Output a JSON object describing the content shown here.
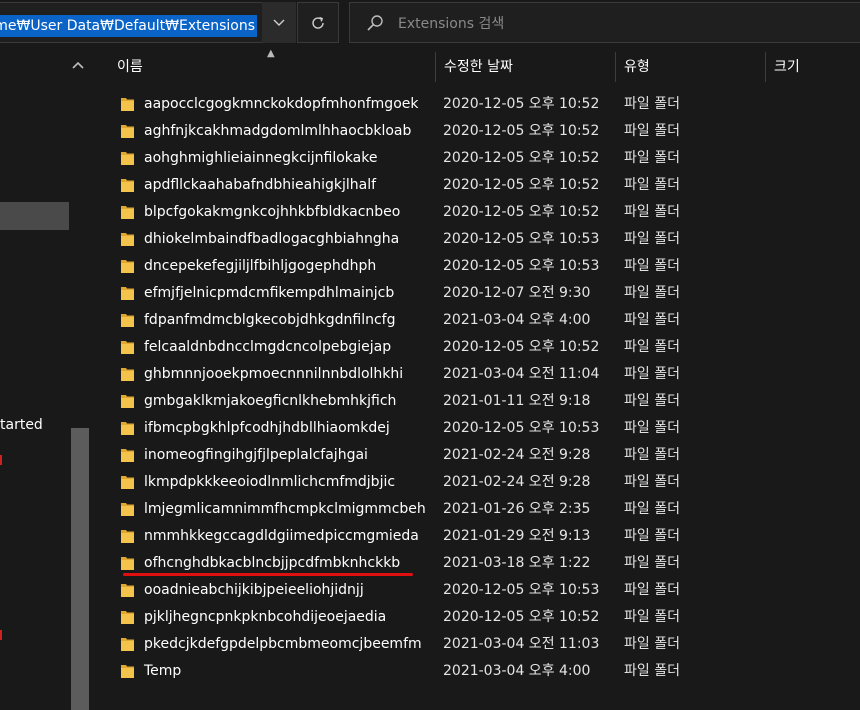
{
  "address_bar": {
    "path": "ome₩User Data₩Default₩Extensions"
  },
  "search": {
    "placeholder": "Extensions 검색"
  },
  "nav": {
    "partial_label": "tarted"
  },
  "columns": {
    "name": "이름",
    "date": "수정한 날짜",
    "type": "유형",
    "size": "크기"
  },
  "rows": [
    {
      "name": "aapocclcgogkmnckokdopfmhonfmgoek",
      "date": "2020-12-05 오후 10:52",
      "type": "파일 폴더"
    },
    {
      "name": "aghfnjkcakhmadgdomlmlhhaocbkloab",
      "date": "2020-12-05 오후 10:52",
      "type": "파일 폴더"
    },
    {
      "name": "aohghmighlieiainnegkcijnfilokake",
      "date": "2020-12-05 오후 10:52",
      "type": "파일 폴더"
    },
    {
      "name": "apdfllckaahabafndbhieahigkjlhalf",
      "date": "2020-12-05 오후 10:52",
      "type": "파일 폴더"
    },
    {
      "name": "blpcfgokakmgnkcojhhkbfbldkacnbeo",
      "date": "2020-12-05 오후 10:52",
      "type": "파일 폴더"
    },
    {
      "name": "dhiokelmbaindfbadlogacghbiahngha",
      "date": "2020-12-05 오후 10:53",
      "type": "파일 폴더"
    },
    {
      "name": "dncepekefegjiljlfbihljgogephdhph",
      "date": "2020-12-05 오후 10:53",
      "type": "파일 폴더"
    },
    {
      "name": "efmjfjelnicpmdcmfikempdhlmainjcb",
      "date": "2020-12-07 오전 9:30",
      "type": "파일 폴더"
    },
    {
      "name": "fdpanfmdmcblgkecobjdhkgdnfilncfg",
      "date": "2021-03-04 오후 4:00",
      "type": "파일 폴더"
    },
    {
      "name": "felcaaldnbdncclmgdcncolpebgiejap",
      "date": "2020-12-05 오후 10:52",
      "type": "파일 폴더"
    },
    {
      "name": "ghbmnnjooekpmoecnnnilnnbdlolhkhi",
      "date": "2021-03-04 오전 11:04",
      "type": "파일 폴더"
    },
    {
      "name": "gmbgaklkmjakoegficnlkhebmhkjfich",
      "date": "2021-01-11 오전 9:18",
      "type": "파일 폴더"
    },
    {
      "name": "ifbmcpbgkhlpfcodhjhdbllhiaomkdej",
      "date": "2020-12-05 오후 10:53",
      "type": "파일 폴더"
    },
    {
      "name": "inomeogfingihgjfjlpeplalcfajhgai",
      "date": "2021-02-24 오전 9:28",
      "type": "파일 폴더"
    },
    {
      "name": "lkmpdpkkkeeoiodlnmlichcmfmdjbjic",
      "date": "2021-02-24 오전 9:28",
      "type": "파일 폴더"
    },
    {
      "name": "lmjegmlicamnimmfhcmpkclmigmmcbeh",
      "date": "2021-01-26 오후 2:35",
      "type": "파일 폴더"
    },
    {
      "name": "nmmhkkegccagdldgiimedpiccmgmieda",
      "date": "2021-01-29 오전 9:13",
      "type": "파일 폴더"
    },
    {
      "name": "ofhcnghdbkacblncbjjpcdfmbknhckkb",
      "date": "2021-03-18 오후 1:22",
      "type": "파일 폴더"
    },
    {
      "name": "ooadnieabchijkibjpeieeliohjidnjj",
      "date": "2020-12-05 오후 10:53",
      "type": "파일 폴더"
    },
    {
      "name": "pjkljhegncpnkpknbcohdijeoejaedia",
      "date": "2020-12-05 오후 10:52",
      "type": "파일 폴더"
    },
    {
      "name": "pkedcjkdefgpdelpbcmbmeomcjbeemfm",
      "date": "2021-03-04 오전 11:03",
      "type": "파일 폴더"
    },
    {
      "name": "Temp",
      "date": "2021-03-04 오후 4:00",
      "type": "파일 폴더"
    }
  ],
  "highlighted_row": 17,
  "icons": {
    "folder": "folder-icon",
    "search": "search-icon",
    "refresh": "refresh-icon",
    "dropdown": "chevron-down-icon"
  },
  "colors": {
    "folder": "#f4c34b",
    "selection": "#0a64c8",
    "underline": "#e01010"
  }
}
